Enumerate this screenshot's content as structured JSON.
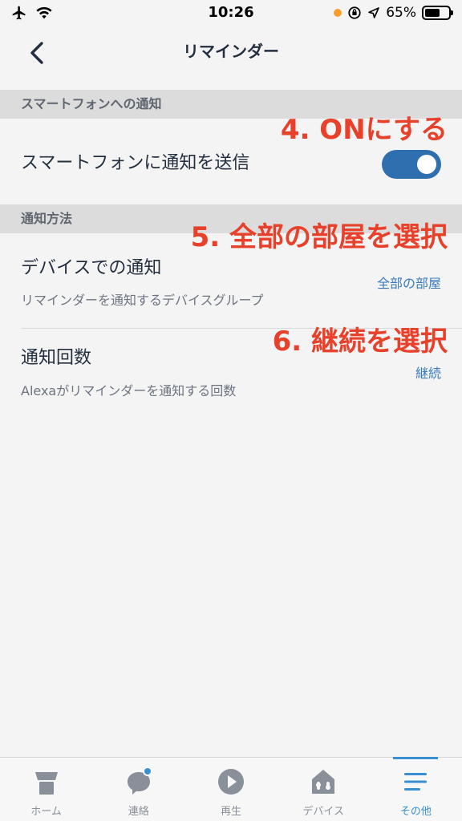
{
  "status_bar": {
    "time": "10:26",
    "battery_percent": "65%",
    "battery_level": 0.65,
    "icons": [
      "airplane-icon",
      "wifi-icon",
      "orange-dot-icon",
      "rotation-lock-icon",
      "location-icon",
      "battery-icon"
    ]
  },
  "nav": {
    "title": "リマインダー",
    "back_icon": "chevron-left-icon"
  },
  "sections": {
    "smartphone": {
      "header": "スマートフォンへの通知",
      "row_title": "スマートフォンに通知を送信",
      "toggle_on": true
    },
    "method": {
      "header": "通知方法",
      "devices": {
        "title": "デバイスでの通知",
        "subtitle": "リマインダーを通知するデバイスグループ",
        "value": "全部の部屋"
      },
      "count": {
        "title": "通知回数",
        "subtitle": "Alexaがリマインダーを通知する回数",
        "value": "継続"
      }
    }
  },
  "annotations": {
    "step4": "4. ONにする",
    "step5": "5. 全部の部屋を選択",
    "step6": "6. 継続を選択"
  },
  "tabs": [
    {
      "label": "ホーム",
      "icon": "home-icon",
      "active": false
    },
    {
      "label": "連絡",
      "icon": "chat-bubble-icon",
      "active": false
    },
    {
      "label": "再生",
      "icon": "play-icon",
      "active": false
    },
    {
      "label": "デバイス",
      "icon": "device-house-icon",
      "active": false
    },
    {
      "label": "その他",
      "icon": "menu-icon",
      "active": true
    }
  ],
  "colors": {
    "accent": "#3a8fd1",
    "toggle": "#2f6fb0",
    "annotation": "#e8412b",
    "link": "#3a7bbd"
  }
}
